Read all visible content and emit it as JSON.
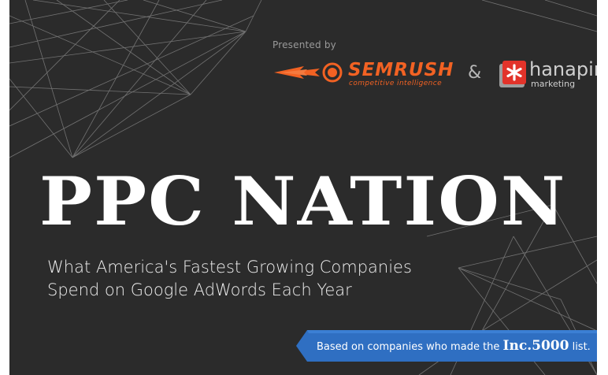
{
  "presented_by": "Presented by",
  "sponsors": {
    "semrush": {
      "name": "SEMRUSH",
      "tagline": "competitive intelligence"
    },
    "connector": "&",
    "hanapin": {
      "name": "hanapin",
      "sub": "marketing"
    }
  },
  "headline": "PPC NATION",
  "subtitle": {
    "line1": "What America's Fastest Growing Companies",
    "line2": "Spend on Google AdWords Each Year"
  },
  "ribbon": {
    "prefix": "Based on companies who made the ",
    "brand": "Inc.5000",
    "suffix": " list."
  },
  "colors": {
    "background": "#2b2b2b",
    "semrush_orange": "#f26223",
    "hanapin_red": "#e2332a",
    "ribbon_blue": "#2f6fc2"
  },
  "icons": [
    "network-lines-decoration",
    "semrush-rocket-icon",
    "hanapin-asterisk-icon"
  ]
}
